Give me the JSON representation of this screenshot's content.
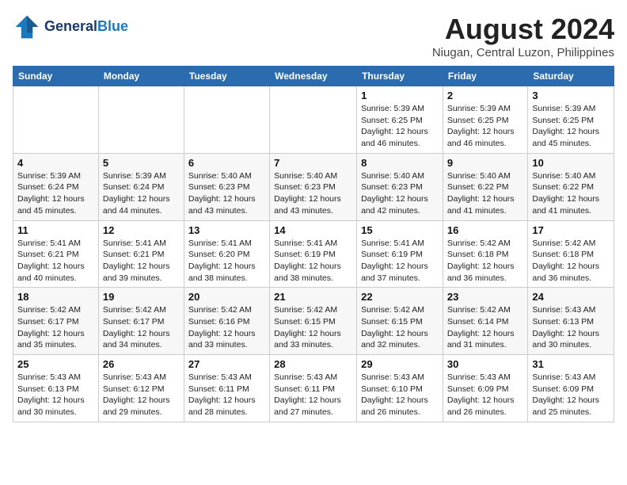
{
  "header": {
    "logo_line1": "General",
    "logo_line2": "Blue",
    "month_title": "August 2024",
    "location": "Niugan, Central Luzon, Philippines"
  },
  "weekdays": [
    "Sunday",
    "Monday",
    "Tuesday",
    "Wednesday",
    "Thursday",
    "Friday",
    "Saturday"
  ],
  "weeks": [
    [
      {
        "day": "",
        "info": ""
      },
      {
        "day": "",
        "info": ""
      },
      {
        "day": "",
        "info": ""
      },
      {
        "day": "",
        "info": ""
      },
      {
        "day": "1",
        "info": "Sunrise: 5:39 AM\nSunset: 6:25 PM\nDaylight: 12 hours\nand 46 minutes."
      },
      {
        "day": "2",
        "info": "Sunrise: 5:39 AM\nSunset: 6:25 PM\nDaylight: 12 hours\nand 46 minutes."
      },
      {
        "day": "3",
        "info": "Sunrise: 5:39 AM\nSunset: 6:25 PM\nDaylight: 12 hours\nand 45 minutes."
      }
    ],
    [
      {
        "day": "4",
        "info": "Sunrise: 5:39 AM\nSunset: 6:24 PM\nDaylight: 12 hours\nand 45 minutes."
      },
      {
        "day": "5",
        "info": "Sunrise: 5:39 AM\nSunset: 6:24 PM\nDaylight: 12 hours\nand 44 minutes."
      },
      {
        "day": "6",
        "info": "Sunrise: 5:40 AM\nSunset: 6:23 PM\nDaylight: 12 hours\nand 43 minutes."
      },
      {
        "day": "7",
        "info": "Sunrise: 5:40 AM\nSunset: 6:23 PM\nDaylight: 12 hours\nand 43 minutes."
      },
      {
        "day": "8",
        "info": "Sunrise: 5:40 AM\nSunset: 6:23 PM\nDaylight: 12 hours\nand 42 minutes."
      },
      {
        "day": "9",
        "info": "Sunrise: 5:40 AM\nSunset: 6:22 PM\nDaylight: 12 hours\nand 41 minutes."
      },
      {
        "day": "10",
        "info": "Sunrise: 5:40 AM\nSunset: 6:22 PM\nDaylight: 12 hours\nand 41 minutes."
      }
    ],
    [
      {
        "day": "11",
        "info": "Sunrise: 5:41 AM\nSunset: 6:21 PM\nDaylight: 12 hours\nand 40 minutes."
      },
      {
        "day": "12",
        "info": "Sunrise: 5:41 AM\nSunset: 6:21 PM\nDaylight: 12 hours\nand 39 minutes."
      },
      {
        "day": "13",
        "info": "Sunrise: 5:41 AM\nSunset: 6:20 PM\nDaylight: 12 hours\nand 38 minutes."
      },
      {
        "day": "14",
        "info": "Sunrise: 5:41 AM\nSunset: 6:19 PM\nDaylight: 12 hours\nand 38 minutes."
      },
      {
        "day": "15",
        "info": "Sunrise: 5:41 AM\nSunset: 6:19 PM\nDaylight: 12 hours\nand 37 minutes."
      },
      {
        "day": "16",
        "info": "Sunrise: 5:42 AM\nSunset: 6:18 PM\nDaylight: 12 hours\nand 36 minutes."
      },
      {
        "day": "17",
        "info": "Sunrise: 5:42 AM\nSunset: 6:18 PM\nDaylight: 12 hours\nand 36 minutes."
      }
    ],
    [
      {
        "day": "18",
        "info": "Sunrise: 5:42 AM\nSunset: 6:17 PM\nDaylight: 12 hours\nand 35 minutes."
      },
      {
        "day": "19",
        "info": "Sunrise: 5:42 AM\nSunset: 6:17 PM\nDaylight: 12 hours\nand 34 minutes."
      },
      {
        "day": "20",
        "info": "Sunrise: 5:42 AM\nSunset: 6:16 PM\nDaylight: 12 hours\nand 33 minutes."
      },
      {
        "day": "21",
        "info": "Sunrise: 5:42 AM\nSunset: 6:15 PM\nDaylight: 12 hours\nand 33 minutes."
      },
      {
        "day": "22",
        "info": "Sunrise: 5:42 AM\nSunset: 6:15 PM\nDaylight: 12 hours\nand 32 minutes."
      },
      {
        "day": "23",
        "info": "Sunrise: 5:42 AM\nSunset: 6:14 PM\nDaylight: 12 hours\nand 31 minutes."
      },
      {
        "day": "24",
        "info": "Sunrise: 5:43 AM\nSunset: 6:13 PM\nDaylight: 12 hours\nand 30 minutes."
      }
    ],
    [
      {
        "day": "25",
        "info": "Sunrise: 5:43 AM\nSunset: 6:13 PM\nDaylight: 12 hours\nand 30 minutes."
      },
      {
        "day": "26",
        "info": "Sunrise: 5:43 AM\nSunset: 6:12 PM\nDaylight: 12 hours\nand 29 minutes."
      },
      {
        "day": "27",
        "info": "Sunrise: 5:43 AM\nSunset: 6:11 PM\nDaylight: 12 hours\nand 28 minutes."
      },
      {
        "day": "28",
        "info": "Sunrise: 5:43 AM\nSunset: 6:11 PM\nDaylight: 12 hours\nand 27 minutes."
      },
      {
        "day": "29",
        "info": "Sunrise: 5:43 AM\nSunset: 6:10 PM\nDaylight: 12 hours\nand 26 minutes."
      },
      {
        "day": "30",
        "info": "Sunrise: 5:43 AM\nSunset: 6:09 PM\nDaylight: 12 hours\nand 26 minutes."
      },
      {
        "day": "31",
        "info": "Sunrise: 5:43 AM\nSunset: 6:09 PM\nDaylight: 12 hours\nand 25 minutes."
      }
    ]
  ]
}
